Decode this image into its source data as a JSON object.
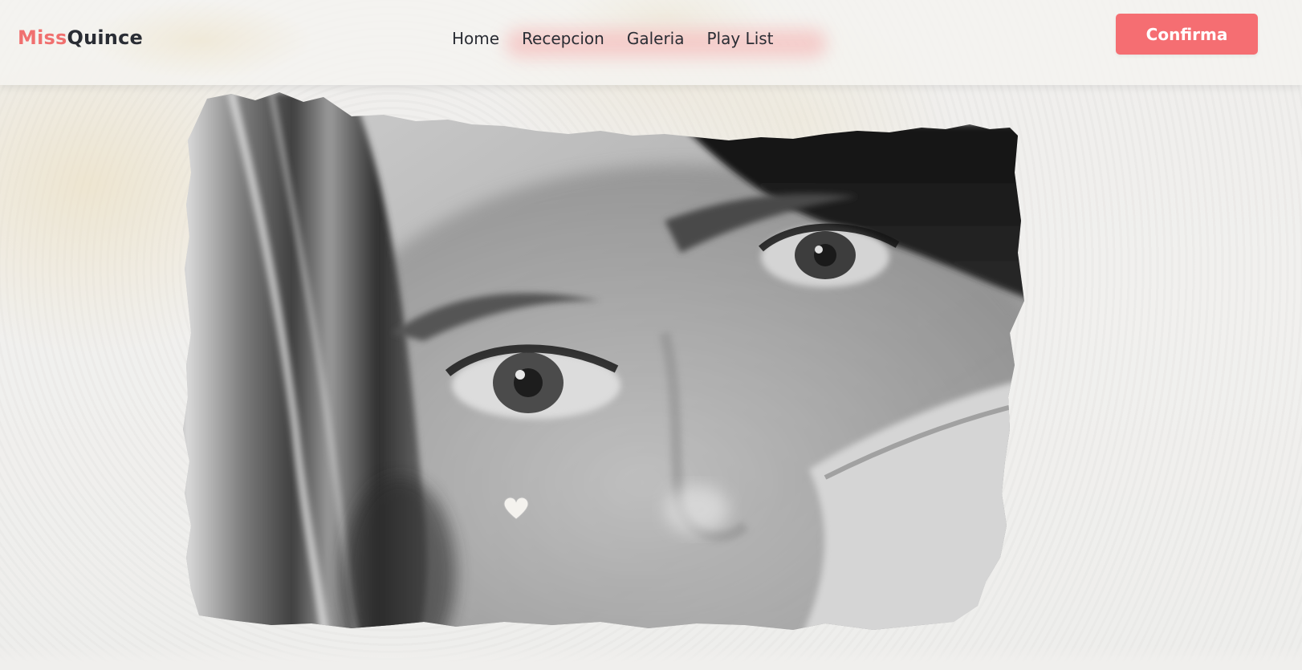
{
  "header": {
    "brand_accent": "Miss",
    "brand_main": "Quince",
    "nav": [
      {
        "label": "Home"
      },
      {
        "label": "Recepcion"
      },
      {
        "label": "Galeria"
      },
      {
        "label": "Play List"
      }
    ],
    "cta_label": "Confirma"
  },
  "hero": {
    "image": "grayscale-portrait-photo",
    "style": "torn-paper-edge",
    "decoration": "heart-sticker"
  },
  "colors": {
    "accent": "#f56e72",
    "text": "#2a2d34",
    "background": "#f0efed"
  }
}
